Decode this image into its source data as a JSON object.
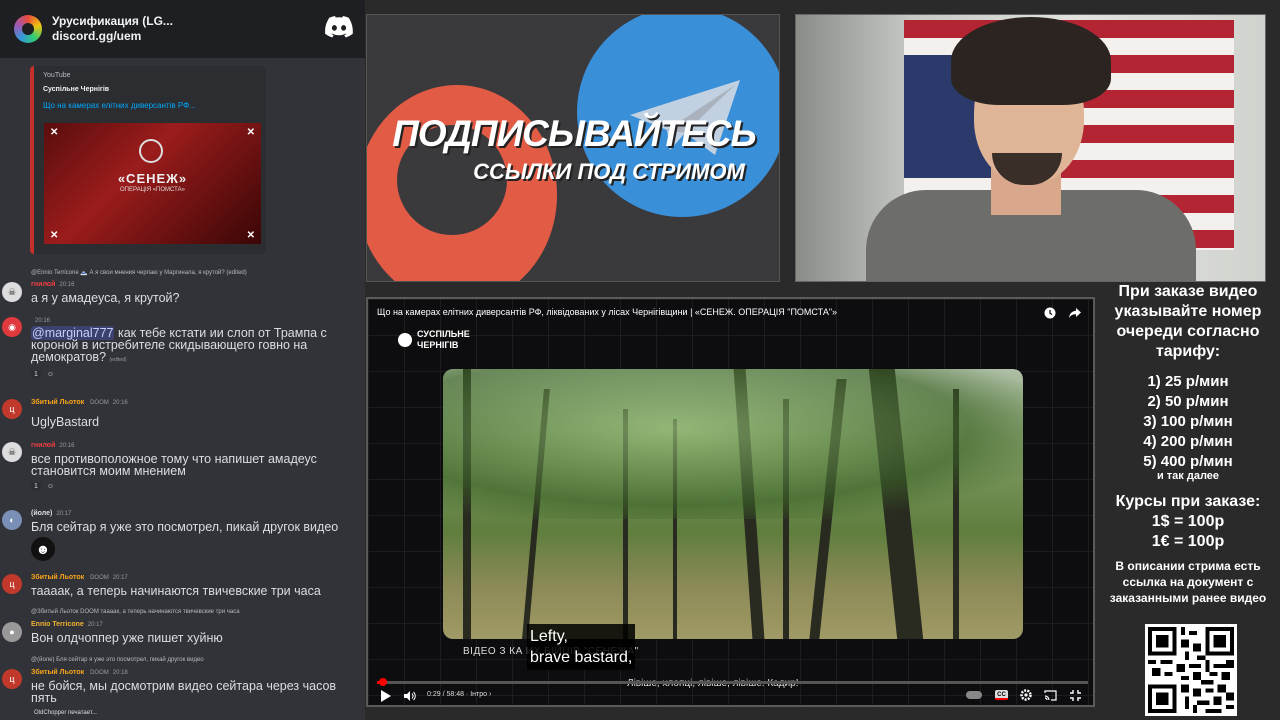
{
  "chat": {
    "server_name": "Урусификация (LG...",
    "invite": "discord.gg/uem",
    "embed": {
      "provider": "YouTube",
      "author": "Суспільне Чернігів",
      "title": "Що на камерах елітних диверсантів РФ...",
      "thumb_title": "«СЕНЕЖ»",
      "thumb_sub": "ОПЕРАЦІЯ «ПОМСТА»"
    },
    "messages": [
      {
        "reply": "@Ennio Terricone 🗻 А я свои мнения черпаю у Маргинала, я крутой? (edited)",
        "author": "гнилой",
        "time": "20:16",
        "text": "а я у амадеуса, я крутой?",
        "color": "#f23f43"
      },
      {
        "author": "",
        "time": "20:16",
        "mention": "@marginal777",
        "text": " как тебе кстати ии слоп от Трампа с короной в истребителе скидывающего говно на демократов?",
        "edited": "(edited)",
        "reactions": [
          "1",
          "☺"
        ],
        "color": "#dbdee1"
      },
      {
        "author": "Збитый Льоток",
        "tag": "DOOM",
        "time": "20:16",
        "text": "UglyBastard",
        "color": "#faa61a"
      },
      {
        "author": "гнилой",
        "time": "20:16",
        "text": "все противоположное тому что напишет амадеус становится моим мнением",
        "reactions": [
          "1",
          "☺"
        ],
        "color": "#f23f43"
      },
      {
        "author": "(йоле)",
        "time": "20:17",
        "text": "Бля сейтар я уже это посмотрел, пикай другок видео",
        "color": "#dbdee1"
      },
      {
        "author": "Збитый Льоток",
        "tag": "DOOM",
        "time": "20:17",
        "text": "таааак, а теперь начинаются твичевские три часа",
        "color": "#faa61a"
      },
      {
        "reply": "@Збитый Льоток DOOM таааак, а теперь начинаются твичевские три часа",
        "author": "Ennio Terricone",
        "time": "20:17",
        "text": "Вон олдчоппер уже пишет хуйню",
        "color": "#f0b232"
      },
      {
        "reply": "@(йоле) Бля сейтар я уже это посмотрел, пикай другок видео",
        "author": "Збитый Льоток",
        "tag": "DOOM",
        "time": "20:18",
        "text": "не бойся, мы досмотрим видео сейтара через часов пять",
        "color": "#faa61a"
      }
    ],
    "typing": "OldChopper печатает..."
  },
  "banner": {
    "title": "ПОДПИСЫВАЙТЕСЬ",
    "subtitle": "ССЫЛКИ ПОД СТРИМОМ"
  },
  "player": {
    "title": "Що на камерах елітних диверсантів РФ, ліквідованих у лісах Чернігівщини | «СЕНЕЖ. ОПЕРАЦІЯ \"ПОМСТА\"»",
    "channel": "СУСПІЛЬНЕ ЧЕРНІГІВ",
    "caption_line": "ВІДЕО З КА                        ИХ БІЙЦІВ \"СЕНЕЖА\"",
    "subtitle_1": "Lefty,",
    "subtitle_2": "brave bastard,",
    "bottom_caption": "Лівіше, хлопці, лівіше, лівіше. Кадир!",
    "time": "0:29 / 58:48 · Інтро ›",
    "progress": 0.008,
    "accent": "#ff0000"
  },
  "pricing": {
    "heading": "При заказе видео указывайте номер очереди согласно тарифу:",
    "tiers": [
      "1) 25 р/мин",
      "2) 50 р/мин",
      "3) 100 р/мин",
      "4) 200 р/мин",
      "5) 400 р/мин"
    ],
    "etc": "и так далее",
    "rates_heading": "Курсы при заказе:",
    "rates": [
      "1$ = 100р",
      "1€ = 100р"
    ],
    "note": "В описании стрима есть ссылка на документ с заказанными ранее видео"
  }
}
